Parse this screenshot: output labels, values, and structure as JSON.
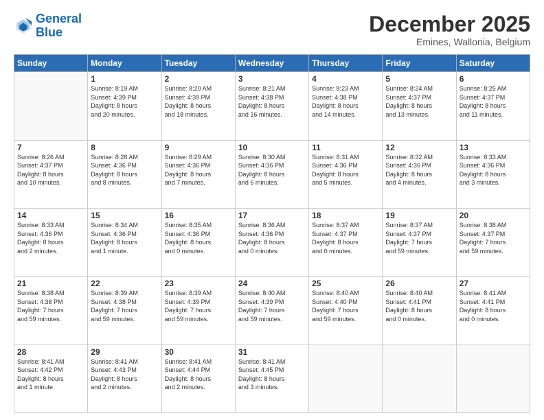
{
  "header": {
    "logo_line1": "General",
    "logo_line2": "Blue",
    "month_title": "December 2025",
    "subtitle": "Emines, Wallonia, Belgium"
  },
  "days_of_week": [
    "Sunday",
    "Monday",
    "Tuesday",
    "Wednesday",
    "Thursday",
    "Friday",
    "Saturday"
  ],
  "weeks": [
    [
      {
        "day": "",
        "content": ""
      },
      {
        "day": "1",
        "content": "Sunrise: 8:19 AM\nSunset: 4:39 PM\nDaylight: 8 hours\nand 20 minutes."
      },
      {
        "day": "2",
        "content": "Sunrise: 8:20 AM\nSunset: 4:39 PM\nDaylight: 8 hours\nand 18 minutes."
      },
      {
        "day": "3",
        "content": "Sunrise: 8:21 AM\nSunset: 4:38 PM\nDaylight: 8 hours\nand 16 minutes."
      },
      {
        "day": "4",
        "content": "Sunrise: 8:23 AM\nSunset: 4:38 PM\nDaylight: 8 hours\nand 14 minutes."
      },
      {
        "day": "5",
        "content": "Sunrise: 8:24 AM\nSunset: 4:37 PM\nDaylight: 8 hours\nand 13 minutes."
      },
      {
        "day": "6",
        "content": "Sunrise: 8:25 AM\nSunset: 4:37 PM\nDaylight: 8 hours\nand 11 minutes."
      }
    ],
    [
      {
        "day": "7",
        "content": "Sunrise: 8:26 AM\nSunset: 4:37 PM\nDaylight: 8 hours\nand 10 minutes."
      },
      {
        "day": "8",
        "content": "Sunrise: 8:28 AM\nSunset: 4:36 PM\nDaylight: 8 hours\nand 8 minutes."
      },
      {
        "day": "9",
        "content": "Sunrise: 8:29 AM\nSunset: 4:36 PM\nDaylight: 8 hours\nand 7 minutes."
      },
      {
        "day": "10",
        "content": "Sunrise: 8:30 AM\nSunset: 4:36 PM\nDaylight: 8 hours\nand 6 minutes."
      },
      {
        "day": "11",
        "content": "Sunrise: 8:31 AM\nSunset: 4:36 PM\nDaylight: 8 hours\nand 5 minutes."
      },
      {
        "day": "12",
        "content": "Sunrise: 8:32 AM\nSunset: 4:36 PM\nDaylight: 8 hours\nand 4 minutes."
      },
      {
        "day": "13",
        "content": "Sunrise: 8:33 AM\nSunset: 4:36 PM\nDaylight: 8 hours\nand 3 minutes."
      }
    ],
    [
      {
        "day": "14",
        "content": "Sunrise: 8:33 AM\nSunset: 4:36 PM\nDaylight: 8 hours\nand 2 minutes."
      },
      {
        "day": "15",
        "content": "Sunrise: 8:34 AM\nSunset: 4:36 PM\nDaylight: 8 hours\nand 1 minute."
      },
      {
        "day": "16",
        "content": "Sunrise: 8:35 AM\nSunset: 4:36 PM\nDaylight: 8 hours\nand 0 minutes."
      },
      {
        "day": "17",
        "content": "Sunrise: 8:36 AM\nSunset: 4:36 PM\nDaylight: 8 hours\nand 0 minutes."
      },
      {
        "day": "18",
        "content": "Sunrise: 8:37 AM\nSunset: 4:37 PM\nDaylight: 8 hours\nand 0 minutes."
      },
      {
        "day": "19",
        "content": "Sunrise: 8:37 AM\nSunset: 4:37 PM\nDaylight: 7 hours\nand 59 minutes."
      },
      {
        "day": "20",
        "content": "Sunrise: 8:38 AM\nSunset: 4:37 PM\nDaylight: 7 hours\nand 59 minutes."
      }
    ],
    [
      {
        "day": "21",
        "content": "Sunrise: 8:38 AM\nSunset: 4:38 PM\nDaylight: 7 hours\nand 59 minutes."
      },
      {
        "day": "22",
        "content": "Sunrise: 8:39 AM\nSunset: 4:38 PM\nDaylight: 7 hours\nand 59 minutes."
      },
      {
        "day": "23",
        "content": "Sunrise: 8:39 AM\nSunset: 4:39 PM\nDaylight: 7 hours\nand 59 minutes."
      },
      {
        "day": "24",
        "content": "Sunrise: 8:40 AM\nSunset: 4:39 PM\nDaylight: 7 hours\nand 59 minutes."
      },
      {
        "day": "25",
        "content": "Sunrise: 8:40 AM\nSunset: 4:40 PM\nDaylight: 7 hours\nand 59 minutes."
      },
      {
        "day": "26",
        "content": "Sunrise: 8:40 AM\nSunset: 4:41 PM\nDaylight: 8 hours\nand 0 minutes."
      },
      {
        "day": "27",
        "content": "Sunrise: 8:41 AM\nSunset: 4:41 PM\nDaylight: 8 hours\nand 0 minutes."
      }
    ],
    [
      {
        "day": "28",
        "content": "Sunrise: 8:41 AM\nSunset: 4:42 PM\nDaylight: 8 hours\nand 1 minute."
      },
      {
        "day": "29",
        "content": "Sunrise: 8:41 AM\nSunset: 4:43 PM\nDaylight: 8 hours\nand 2 minutes."
      },
      {
        "day": "30",
        "content": "Sunrise: 8:41 AM\nSunset: 4:44 PM\nDaylight: 8 hours\nand 2 minutes."
      },
      {
        "day": "31",
        "content": "Sunrise: 8:41 AM\nSunset: 4:45 PM\nDaylight: 8 hours\nand 3 minutes."
      },
      {
        "day": "",
        "content": ""
      },
      {
        "day": "",
        "content": ""
      },
      {
        "day": "",
        "content": ""
      }
    ]
  ]
}
